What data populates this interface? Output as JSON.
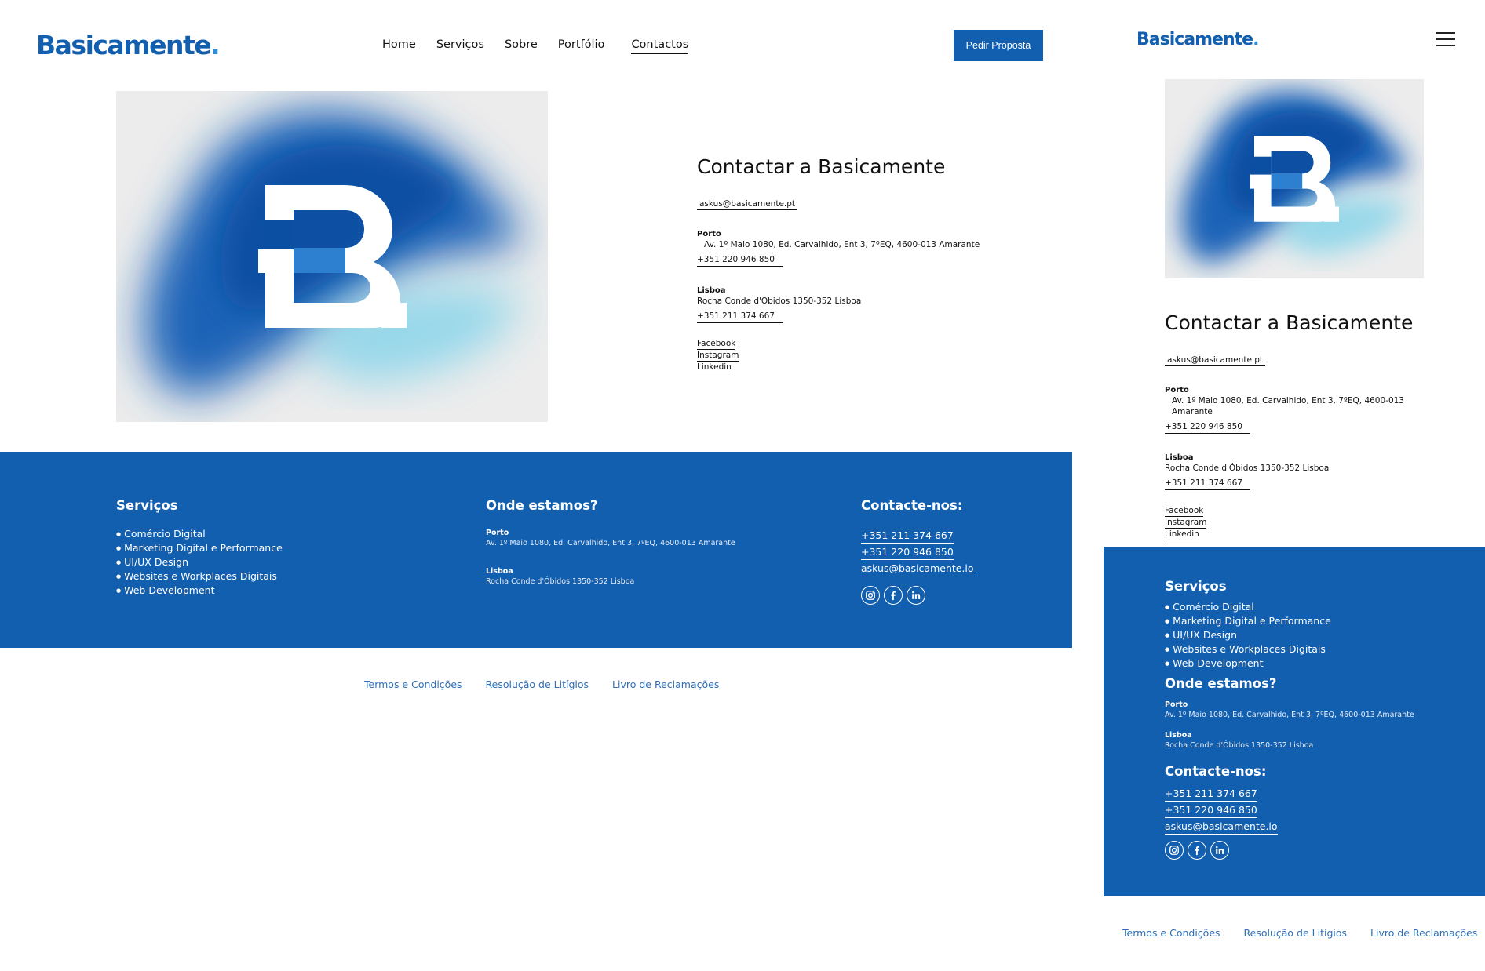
{
  "brand": {
    "name": "Basicamente",
    "dot": ".",
    "color": "#125fb0"
  },
  "nav": {
    "items": [
      {
        "label": "Home"
      },
      {
        "label": "Serviços"
      },
      {
        "label": "Sobre"
      },
      {
        "label": "Portfólio"
      },
      {
        "label": "Contactos",
        "active": true
      }
    ],
    "cta_label": "Pedir Proposta"
  },
  "hero": {
    "letter": "B",
    "dot": "."
  },
  "contact": {
    "title": "Contactar a Basicamente",
    "email": "askus@basicamente.pt",
    "porto": {
      "city": "Porto",
      "address": "Av. 1º Maio 1080, Ed. Carvalhido, Ent 3, 7ºEQ, 4600-013 Amarante",
      "phone": "+351 220 946 850"
    },
    "lisboa": {
      "city": "Lisboa",
      "address": "Rocha Conde d'Óbidos 1350-352 Lisboa",
      "phone": "+351 211 374 667"
    },
    "socials": [
      "Facebook",
      "Instagram",
      "Linkedin"
    ]
  },
  "footer": {
    "services_title": "Serviços",
    "services": [
      "Comércio Digital",
      "Marketing Digital e Performance",
      "UI/UX Design",
      "Websites e Workplaces Digitais",
      "Web Development"
    ],
    "where_title": "Onde estamos?",
    "porto_city": "Porto",
    "porto_address": "Av. 1º Maio 1080, Ed. Carvalhido, Ent 3, 7ºEQ, 4600-013 Amarante",
    "lisboa_city": "Lisboa",
    "lisboa_address": "Rocha Conde d'Óbidos 1350-352 Lisboa",
    "contact_title": "Contacte-nos:",
    "phone_1": "+351 211 374 667",
    "phone_2": "+351 220 946 850",
    "email": "askus@basicamente.io",
    "social_icons": [
      "instagram-icon",
      "facebook-icon",
      "linkedin-icon"
    ],
    "bg_color": "#125fb0"
  },
  "legal": {
    "terms": "Termos e Condições",
    "disputes": "Resolução de Litígios",
    "complaints": "Livro de Reclamações"
  }
}
